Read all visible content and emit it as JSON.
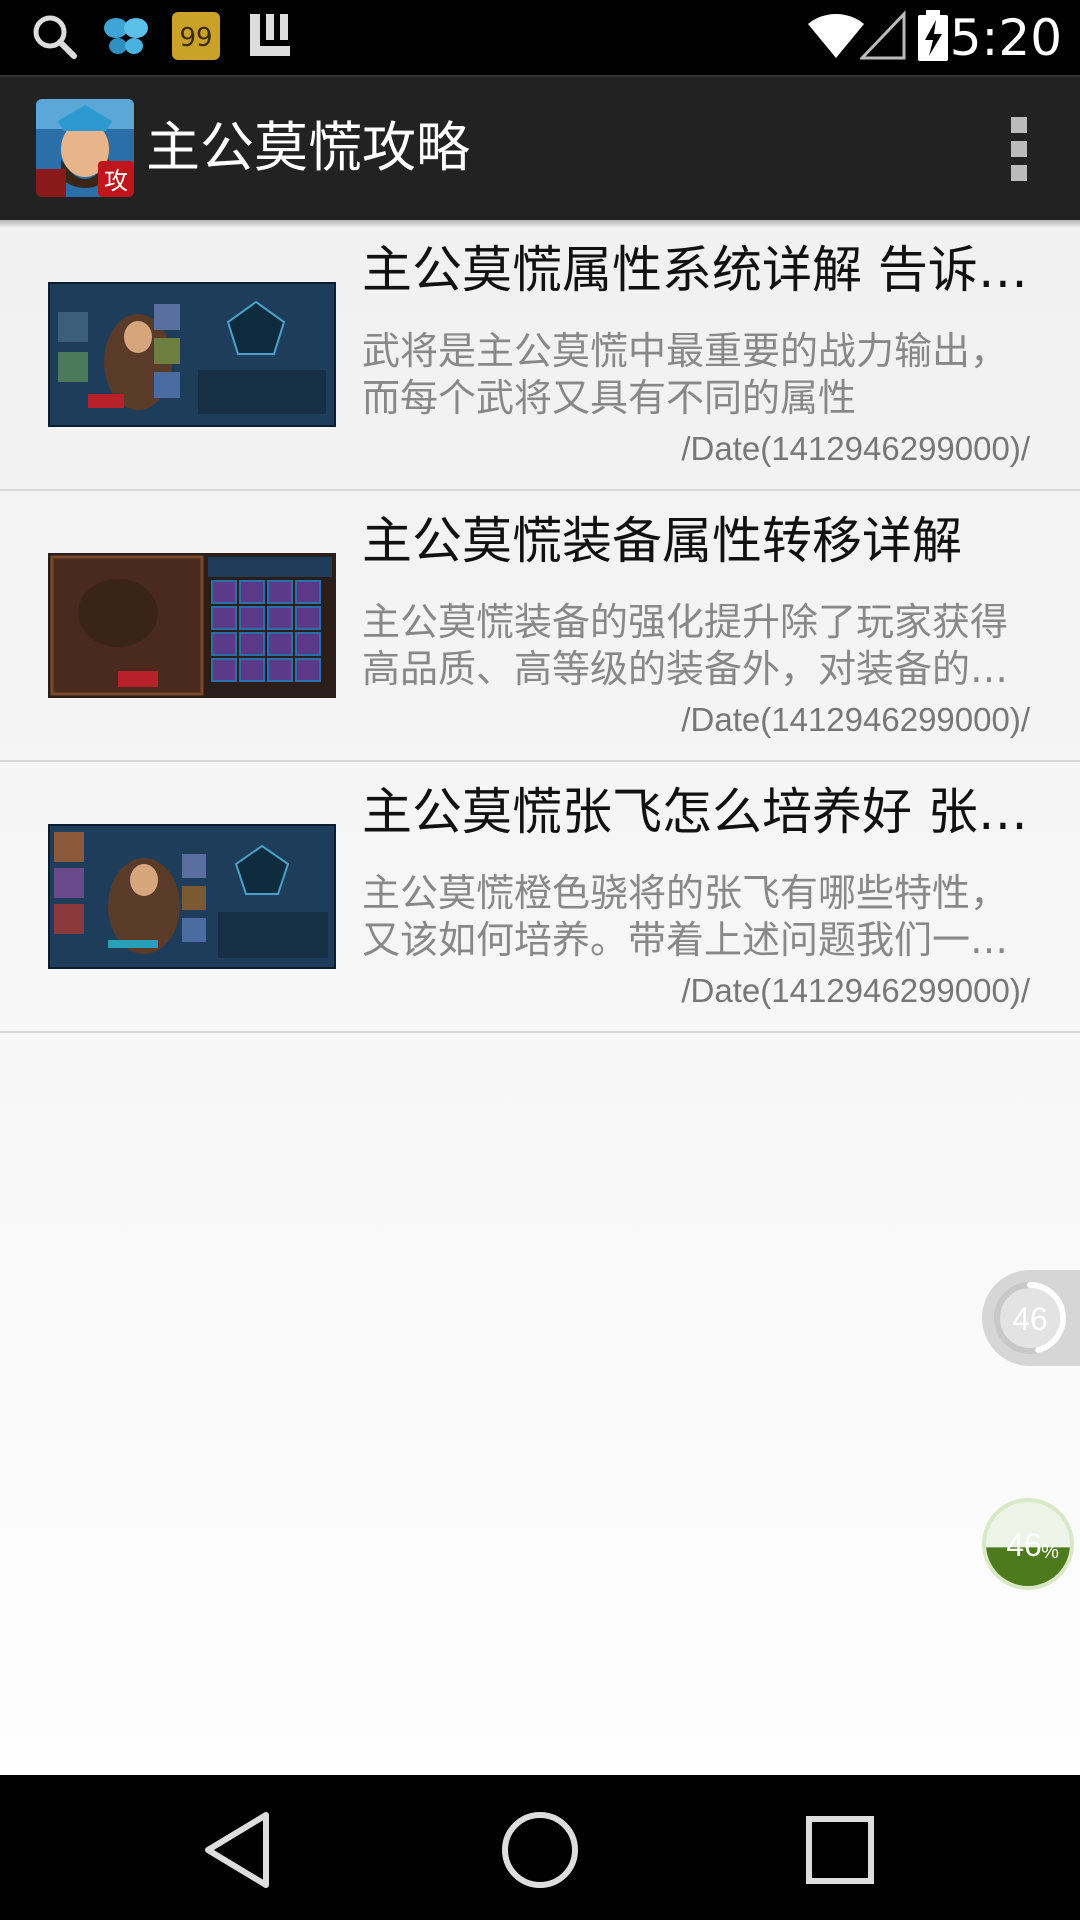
{
  "status_bar": {
    "time": "5:20",
    "icons": [
      "search-icon",
      "butterfly-icon",
      "notes-app-icon",
      "bracket-app-icon",
      "wifi-icon",
      "signal-icon",
      "battery-charging-icon"
    ]
  },
  "app_bar": {
    "icon_badge": "攻",
    "title": "主公莫慌攻略",
    "menu_icon": "overflow-menu-icon"
  },
  "articles": [
    {
      "title": "主公莫慌属性系统详解 告诉你属性的作用",
      "desc": "武将是主公莫慌中最重要的战力输出，而每个武将又具有不同的属性",
      "date": "/Date(1412946299000)/"
    },
    {
      "title": "主公莫慌装备属性转移详解",
      "desc": "主公莫慌装备的强化提升除了玩家获得高品质、高等级的装备外，对装备的强化",
      "date": "/Date(1412946299000)/"
    },
    {
      "title": "主公莫慌张飞怎么培养好 张飞培养攻略",
      "desc": "主公莫慌橙色骁将的张飞有哪些特性，又该如何培养。带着上述问题我们一起来看",
      "date": "/Date(1412946299000)/"
    }
  ],
  "float_counter": {
    "value": "46",
    "progress": 0.46
  },
  "float_percent": {
    "value": "46",
    "unit": "%",
    "fill": 0.46
  },
  "nav_bar": {
    "icons": [
      "back-icon",
      "home-icon",
      "recents-icon"
    ]
  },
  "colors": {
    "status_bar": "#000000",
    "action_bar": "#222222",
    "title_text": "#111111",
    "desc_text": "#888888",
    "percent_fill": "#4e7a1e"
  }
}
